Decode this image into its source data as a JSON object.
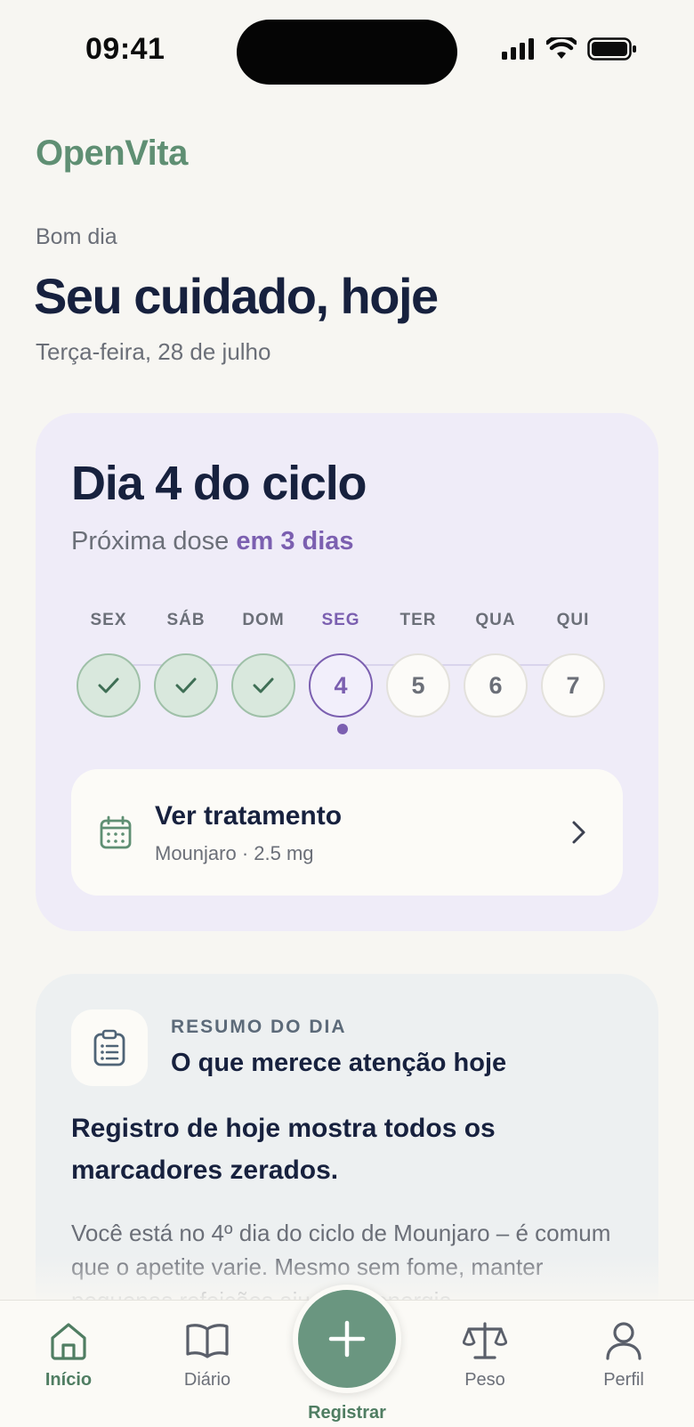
{
  "status_bar": {
    "time": "09:41"
  },
  "brand": "OpenVita",
  "header": {
    "greeting": "Bom dia",
    "title": "Seu cuidado, hoje",
    "date": "Terça-feira, 28 de julho"
  },
  "cycle": {
    "title": "Dia 4 do ciclo",
    "next_dose_prefix": "Próxima dose",
    "next_dose_accent": "em 3 dias",
    "days": [
      {
        "label": "SEX",
        "value": "",
        "state": "done"
      },
      {
        "label": "SÁB",
        "value": "",
        "state": "done"
      },
      {
        "label": "DOM",
        "value": "",
        "state": "done"
      },
      {
        "label": "SEG",
        "value": "4",
        "state": "current"
      },
      {
        "label": "TER",
        "value": "5",
        "state": "future"
      },
      {
        "label": "QUA",
        "value": "6",
        "state": "future"
      },
      {
        "label": "QUI",
        "value": "7",
        "state": "future"
      }
    ],
    "treatment": {
      "title": "Ver tratamento",
      "subtitle": "Mounjaro · 2.5 mg"
    }
  },
  "summary": {
    "kicker": "RESUMO DO DIA",
    "title": "O que merece atenção hoje",
    "headline": "Registro de hoje mostra todos os marcadores zerados.",
    "body": "Você está no 4º dia do ciclo de Mounjaro – é comum que o apetite varie. Mesmo sem fome, manter pequenas refeições ajuda na energia."
  },
  "tabs": [
    {
      "label": "Início",
      "icon": "home-icon"
    },
    {
      "label": "Diário",
      "icon": "book-icon"
    },
    {
      "label": "Registrar",
      "icon": "plus-icon"
    },
    {
      "label": "Peso",
      "icon": "scale-icon"
    },
    {
      "label": "Perfil",
      "icon": "user-icon"
    }
  ],
  "colors": {
    "brand_green": "#5f8f73",
    "accent_purple": "#7b5fb0",
    "fab_green": "#6a9680",
    "cycle_card_bg": "#efecf8",
    "summary_card_bg": "#edf0f1"
  }
}
